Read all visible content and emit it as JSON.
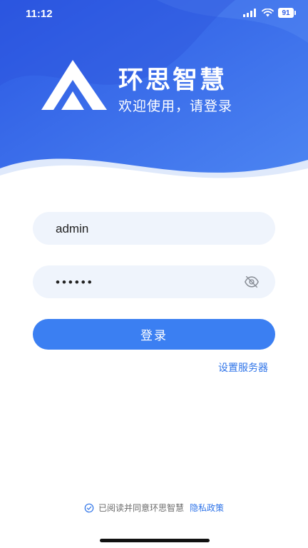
{
  "status_bar": {
    "time": "11:12",
    "battery": "91"
  },
  "brand": {
    "title": "环思智慧",
    "subtitle": "欢迎使用，请登录"
  },
  "form": {
    "username": {
      "value": "admin",
      "placeholder": ""
    },
    "password": {
      "value": "••••••",
      "placeholder": ""
    },
    "login_label": "登录",
    "server_link": "设置服务器"
  },
  "agreement": {
    "text": "已阅读并同意环思智慧",
    "link": "隐私政策"
  },
  "colors": {
    "primary": "#3b7ff2",
    "hero_blue": "#2f5ee5",
    "field_bg": "#eff4fc",
    "link": "#2f74e8"
  },
  "icons": {
    "logo": "triangle-logo-icon",
    "eye": "eye-off-icon",
    "check": "check-circle-icon",
    "signal": "signal-icon",
    "wifi": "wifi-icon",
    "battery": "battery-icon"
  }
}
